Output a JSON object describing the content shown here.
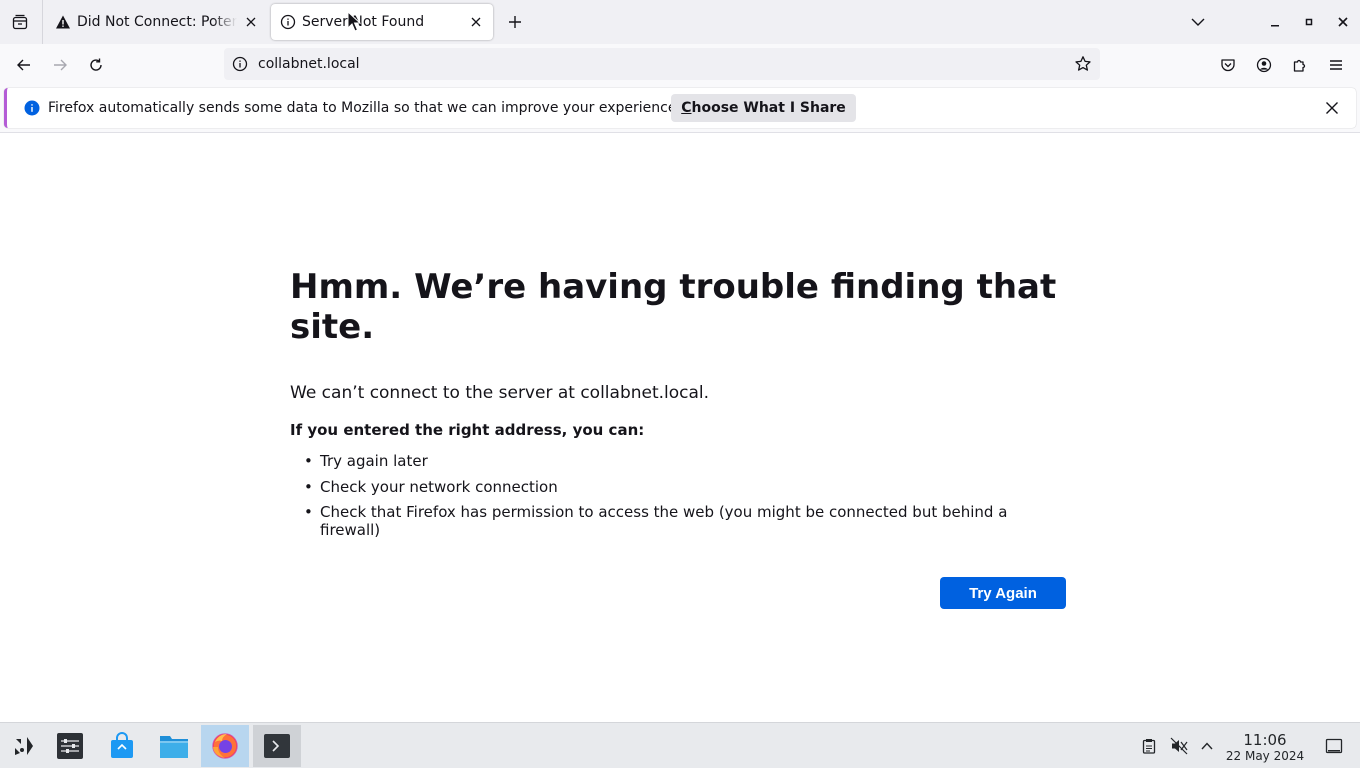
{
  "browser": {
    "tabs": [
      {
        "title": "Did Not Connect: Potential Security Issue",
        "icon": "warning-icon",
        "active": false
      },
      {
        "title": "Server Not Found",
        "icon": "info-icon",
        "active": true
      }
    ],
    "url": "collabnet.local"
  },
  "notification": {
    "text": "Firefox automatically sends some data to Mozilla so that we can improve your experience.",
    "button_first": "C",
    "button_rest": "hoose What I Share"
  },
  "error": {
    "title": "Hmm. We’re having trouble finding that site.",
    "description": "We can’t connect to the server at collabnet.local.",
    "subtitle": "If you entered the right address, you can:",
    "suggestions": [
      "Try again later",
      "Check your network connection",
      "Check that Firefox has permission to access the web (you might be connected but behind a firewall)"
    ],
    "button": "Try Again"
  },
  "taskbar": {
    "time": "11:06",
    "date": "22 May 2024"
  },
  "colors": {
    "accent": "#0061e0",
    "notification_border": "#b45cd6"
  }
}
